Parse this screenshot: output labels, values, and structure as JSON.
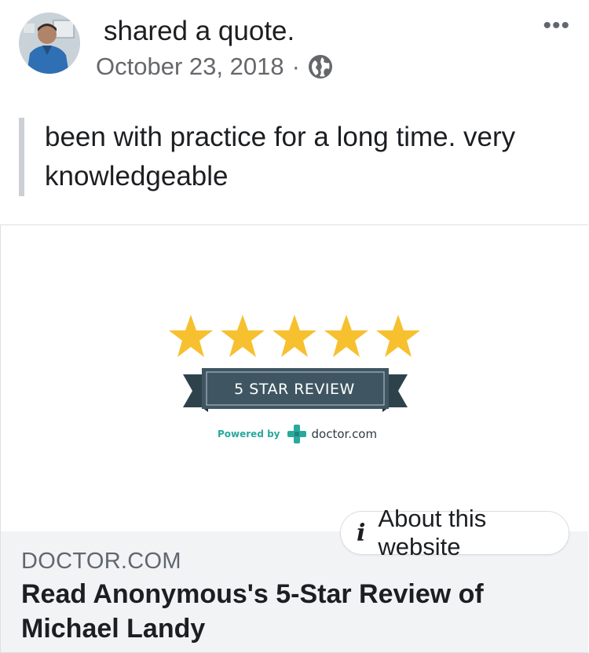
{
  "post": {
    "action_text": "shared a quote.",
    "date": "October 23, 2018",
    "separator": "·",
    "privacy_icon": "globe-icon",
    "more_icon": "more-options-icon",
    "more_label": "•••",
    "quote_text": "been with practice for a long time. very knowledgeable"
  },
  "link_preview": {
    "image": {
      "star_count": 5,
      "star_color": "#f6c02f",
      "ribbon_text": "5 STAR REVIEW",
      "ribbon_color": "#3f5662",
      "powered_by_label": "Powered by",
      "brand_name": "doctor.com",
      "brand_color": "#29a99e"
    },
    "about_button_label": "About this website",
    "domain": "DOCTOR.COM",
    "title": "Read Anonymous's 5-Star Review of Michael Landy"
  }
}
